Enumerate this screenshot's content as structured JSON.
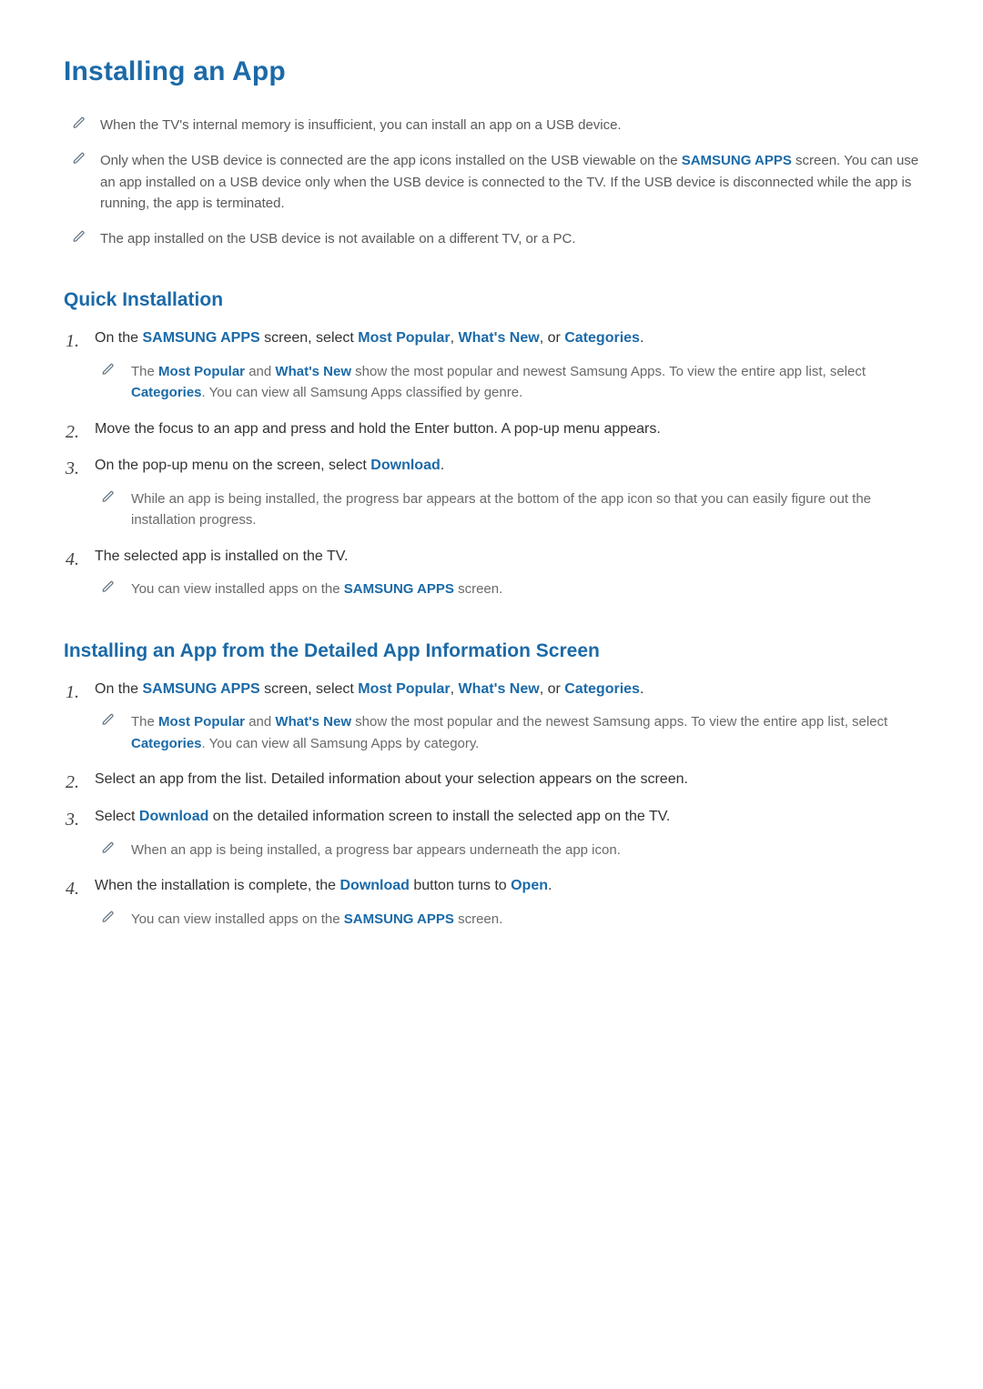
{
  "title": "Installing an App",
  "intro_notes": [
    [
      {
        "t": "When the TV's internal memory is insufficient, you can install an app on a USB device.",
        "c": ""
      }
    ],
    [
      {
        "t": "Only when the USB device is connected are the app icons installed on the USB viewable on the ",
        "c": ""
      },
      {
        "t": "SAMSUNG APPS",
        "c": "kw-bold"
      },
      {
        "t": " screen. You can use an app installed on a USB device only when the USB device is connected to the TV. If the USB device is disconnected while the app is running, the app is terminated.",
        "c": ""
      }
    ],
    [
      {
        "t": "The app installed on the USB device is not available on a different TV, or a PC.",
        "c": ""
      }
    ]
  ],
  "sections": [
    {
      "heading": "Quick Installation",
      "steps": [
        {
          "body": [
            {
              "t": "On the ",
              "c": ""
            },
            {
              "t": "SAMSUNG APPS",
              "c": "kw-bold"
            },
            {
              "t": " screen, select ",
              "c": ""
            },
            {
              "t": "Most Popular",
              "c": "kw-bold"
            },
            {
              "t": ", ",
              "c": ""
            },
            {
              "t": "What's New",
              "c": "kw-bold"
            },
            {
              "t": ", or ",
              "c": ""
            },
            {
              "t": "Categories",
              "c": "kw-bold"
            },
            {
              "t": ".",
              "c": ""
            }
          ],
          "notes": [
            [
              {
                "t": "The ",
                "c": ""
              },
              {
                "t": "Most Popular",
                "c": "kw-bold"
              },
              {
                "t": " and ",
                "c": ""
              },
              {
                "t": "What's New",
                "c": "kw-bold"
              },
              {
                "t": " show the most popular and newest Samsung Apps. To view the entire app list, select ",
                "c": ""
              },
              {
                "t": "Categories",
                "c": "kw-bold"
              },
              {
                "t": ". You can view all Samsung Apps classified by genre.",
                "c": ""
              }
            ]
          ]
        },
        {
          "body": [
            {
              "t": "Move the focus to an app and press and hold the Enter button. A pop-up menu appears.",
              "c": ""
            }
          ],
          "notes": []
        },
        {
          "body": [
            {
              "t": "On the pop-up menu on the screen, select ",
              "c": ""
            },
            {
              "t": "Download",
              "c": "kw-bold"
            },
            {
              "t": ".",
              "c": ""
            }
          ],
          "notes": [
            [
              {
                "t": "While an app is being installed, the progress bar appears at the bottom of the app icon so that you can easily figure out the installation progress.",
                "c": ""
              }
            ]
          ]
        },
        {
          "body": [
            {
              "t": "The selected app is installed on the TV.",
              "c": ""
            }
          ],
          "notes": [
            [
              {
                "t": "You can view installed apps on the ",
                "c": ""
              },
              {
                "t": "SAMSUNG APPS",
                "c": "kw-bold"
              },
              {
                "t": " screen.",
                "c": ""
              }
            ]
          ]
        }
      ]
    },
    {
      "heading": "Installing an App from the Detailed App Information Screen",
      "steps": [
        {
          "body": [
            {
              "t": "On the ",
              "c": ""
            },
            {
              "t": "SAMSUNG APPS",
              "c": "kw-bold"
            },
            {
              "t": " screen, select ",
              "c": ""
            },
            {
              "t": "Most Popular",
              "c": "kw-bold"
            },
            {
              "t": ", ",
              "c": ""
            },
            {
              "t": "What's New",
              "c": "kw-bold"
            },
            {
              "t": ", or ",
              "c": ""
            },
            {
              "t": "Categories",
              "c": "kw-bold"
            },
            {
              "t": ".",
              "c": ""
            }
          ],
          "notes": [
            [
              {
                "t": "The ",
                "c": ""
              },
              {
                "t": "Most Popular",
                "c": "kw-bold"
              },
              {
                "t": " and ",
                "c": ""
              },
              {
                "t": "What's New",
                "c": "kw-bold"
              },
              {
                "t": " show the most popular and the newest Samsung apps. To view the entire app list, select ",
                "c": ""
              },
              {
                "t": "Categories",
                "c": "kw-bold"
              },
              {
                "t": ". You can view all Samsung Apps by category.",
                "c": ""
              }
            ]
          ]
        },
        {
          "body": [
            {
              "t": "Select an app from the list. Detailed information about your selection appears on the screen.",
              "c": ""
            }
          ],
          "notes": []
        },
        {
          "body": [
            {
              "t": "Select ",
              "c": ""
            },
            {
              "t": "Download",
              "c": "kw-bold"
            },
            {
              "t": " on the detailed information screen to install the selected app on the TV.",
              "c": ""
            }
          ],
          "notes": [
            [
              {
                "t": "When an app is being installed, a progress bar appears underneath the app icon.",
                "c": ""
              }
            ]
          ]
        },
        {
          "body": [
            {
              "t": "When the installation is complete, the ",
              "c": ""
            },
            {
              "t": "Download",
              "c": "kw-bold"
            },
            {
              "t": " button turns to ",
              "c": ""
            },
            {
              "t": "Open",
              "c": "kw-bold"
            },
            {
              "t": ".",
              "c": ""
            }
          ],
          "notes": [
            [
              {
                "t": "You can view installed apps on the ",
                "c": ""
              },
              {
                "t": "SAMSUNG APPS",
                "c": "kw-bold"
              },
              {
                "t": " screen.",
                "c": ""
              }
            ]
          ]
        }
      ]
    }
  ]
}
